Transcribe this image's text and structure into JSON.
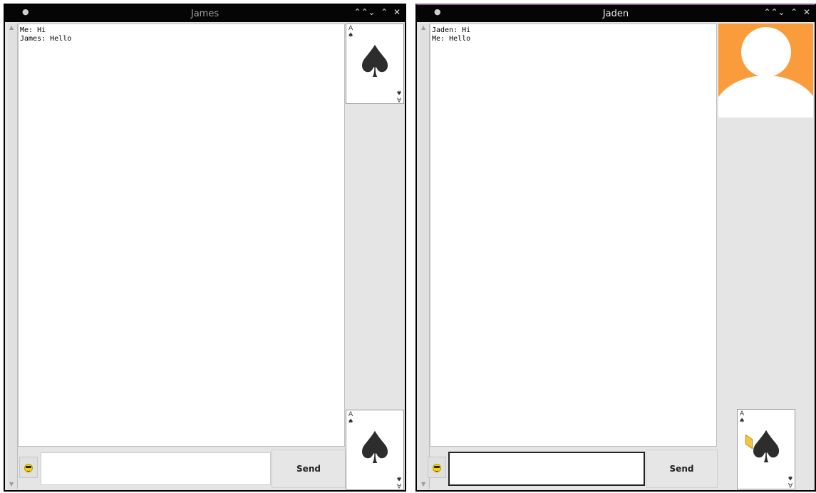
{
  "windows": [
    {
      "title": "James",
      "messages": [
        "Me: Hi",
        "James: Hello"
      ],
      "send_label": "Send",
      "input_value": "",
      "title_controls": [
        "⌃⌃",
        "⌄",
        "⌃",
        "✕"
      ],
      "card_rank": "A",
      "card_suit": "♠"
    },
    {
      "title": "Jaden",
      "messages": [
        "Jaden: Hi",
        "Me: Hello"
      ],
      "send_label": "Send",
      "input_value": "",
      "title_controls": [
        "⌃⌃",
        "⌄",
        "⌃",
        "✕"
      ],
      "card_rank": "A",
      "card_suit": "♠",
      "avatar_color": "#fa9c3c"
    }
  ]
}
